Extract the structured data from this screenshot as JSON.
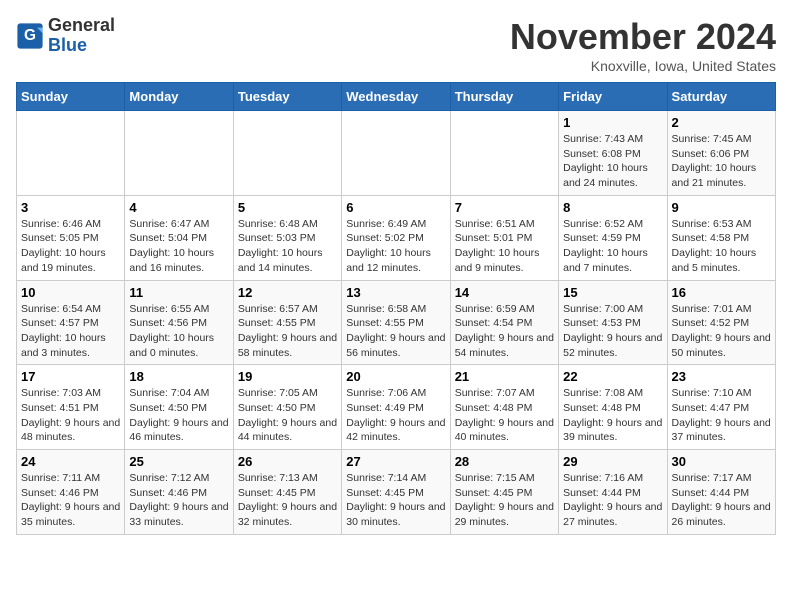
{
  "header": {
    "logo_general": "General",
    "logo_blue": "Blue",
    "month_title": "November 2024",
    "location": "Knoxville, Iowa, United States"
  },
  "days_of_week": [
    "Sunday",
    "Monday",
    "Tuesday",
    "Wednesday",
    "Thursday",
    "Friday",
    "Saturday"
  ],
  "weeks": [
    [
      {
        "day": "",
        "info": ""
      },
      {
        "day": "",
        "info": ""
      },
      {
        "day": "",
        "info": ""
      },
      {
        "day": "",
        "info": ""
      },
      {
        "day": "",
        "info": ""
      },
      {
        "day": "1",
        "info": "Sunrise: 7:43 AM\nSunset: 6:08 PM\nDaylight: 10 hours and 24 minutes."
      },
      {
        "day": "2",
        "info": "Sunrise: 7:45 AM\nSunset: 6:06 PM\nDaylight: 10 hours and 21 minutes."
      }
    ],
    [
      {
        "day": "3",
        "info": "Sunrise: 6:46 AM\nSunset: 5:05 PM\nDaylight: 10 hours and 19 minutes."
      },
      {
        "day": "4",
        "info": "Sunrise: 6:47 AM\nSunset: 5:04 PM\nDaylight: 10 hours and 16 minutes."
      },
      {
        "day": "5",
        "info": "Sunrise: 6:48 AM\nSunset: 5:03 PM\nDaylight: 10 hours and 14 minutes."
      },
      {
        "day": "6",
        "info": "Sunrise: 6:49 AM\nSunset: 5:02 PM\nDaylight: 10 hours and 12 minutes."
      },
      {
        "day": "7",
        "info": "Sunrise: 6:51 AM\nSunset: 5:01 PM\nDaylight: 10 hours and 9 minutes."
      },
      {
        "day": "8",
        "info": "Sunrise: 6:52 AM\nSunset: 4:59 PM\nDaylight: 10 hours and 7 minutes."
      },
      {
        "day": "9",
        "info": "Sunrise: 6:53 AM\nSunset: 4:58 PM\nDaylight: 10 hours and 5 minutes."
      }
    ],
    [
      {
        "day": "10",
        "info": "Sunrise: 6:54 AM\nSunset: 4:57 PM\nDaylight: 10 hours and 3 minutes."
      },
      {
        "day": "11",
        "info": "Sunrise: 6:55 AM\nSunset: 4:56 PM\nDaylight: 10 hours and 0 minutes."
      },
      {
        "day": "12",
        "info": "Sunrise: 6:57 AM\nSunset: 4:55 PM\nDaylight: 9 hours and 58 minutes."
      },
      {
        "day": "13",
        "info": "Sunrise: 6:58 AM\nSunset: 4:55 PM\nDaylight: 9 hours and 56 minutes."
      },
      {
        "day": "14",
        "info": "Sunrise: 6:59 AM\nSunset: 4:54 PM\nDaylight: 9 hours and 54 minutes."
      },
      {
        "day": "15",
        "info": "Sunrise: 7:00 AM\nSunset: 4:53 PM\nDaylight: 9 hours and 52 minutes."
      },
      {
        "day": "16",
        "info": "Sunrise: 7:01 AM\nSunset: 4:52 PM\nDaylight: 9 hours and 50 minutes."
      }
    ],
    [
      {
        "day": "17",
        "info": "Sunrise: 7:03 AM\nSunset: 4:51 PM\nDaylight: 9 hours and 48 minutes."
      },
      {
        "day": "18",
        "info": "Sunrise: 7:04 AM\nSunset: 4:50 PM\nDaylight: 9 hours and 46 minutes."
      },
      {
        "day": "19",
        "info": "Sunrise: 7:05 AM\nSunset: 4:50 PM\nDaylight: 9 hours and 44 minutes."
      },
      {
        "day": "20",
        "info": "Sunrise: 7:06 AM\nSunset: 4:49 PM\nDaylight: 9 hours and 42 minutes."
      },
      {
        "day": "21",
        "info": "Sunrise: 7:07 AM\nSunset: 4:48 PM\nDaylight: 9 hours and 40 minutes."
      },
      {
        "day": "22",
        "info": "Sunrise: 7:08 AM\nSunset: 4:48 PM\nDaylight: 9 hours and 39 minutes."
      },
      {
        "day": "23",
        "info": "Sunrise: 7:10 AM\nSunset: 4:47 PM\nDaylight: 9 hours and 37 minutes."
      }
    ],
    [
      {
        "day": "24",
        "info": "Sunrise: 7:11 AM\nSunset: 4:46 PM\nDaylight: 9 hours and 35 minutes."
      },
      {
        "day": "25",
        "info": "Sunrise: 7:12 AM\nSunset: 4:46 PM\nDaylight: 9 hours and 33 minutes."
      },
      {
        "day": "26",
        "info": "Sunrise: 7:13 AM\nSunset: 4:45 PM\nDaylight: 9 hours and 32 minutes."
      },
      {
        "day": "27",
        "info": "Sunrise: 7:14 AM\nSunset: 4:45 PM\nDaylight: 9 hours and 30 minutes."
      },
      {
        "day": "28",
        "info": "Sunrise: 7:15 AM\nSunset: 4:45 PM\nDaylight: 9 hours and 29 minutes."
      },
      {
        "day": "29",
        "info": "Sunrise: 7:16 AM\nSunset: 4:44 PM\nDaylight: 9 hours and 27 minutes."
      },
      {
        "day": "30",
        "info": "Sunrise: 7:17 AM\nSunset: 4:44 PM\nDaylight: 9 hours and 26 minutes."
      }
    ]
  ]
}
